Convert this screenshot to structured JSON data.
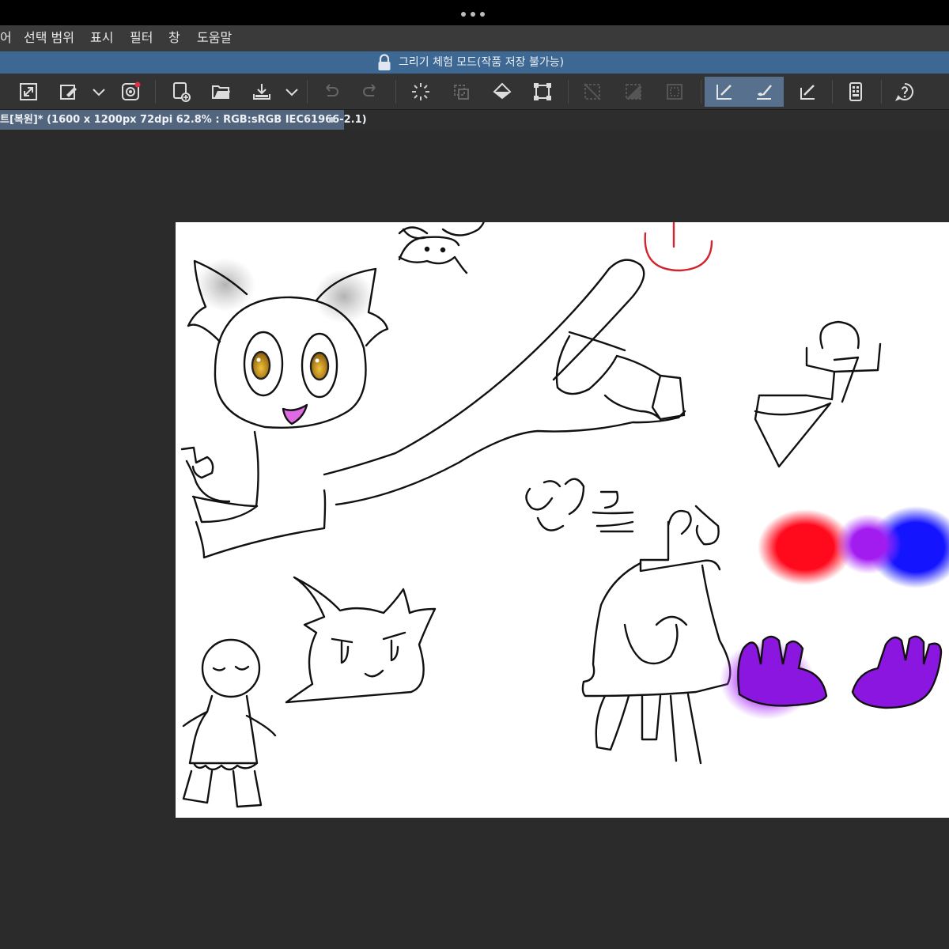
{
  "app": {
    "menu": [
      "어",
      "선택 범위",
      "표시",
      "필터",
      "창",
      "도움말"
    ]
  },
  "banner": {
    "text": "그리기 체험 모드(작품 저장 불가능)"
  },
  "toolbar": {
    "icons": [
      "resize-icon",
      "eyedropper-icon",
      "dropdown-icon",
      "layer-settings-icon",
      "new-canvas-icon",
      "open-folder-icon",
      "save-download-icon",
      "dropdown-icon",
      "undo-icon",
      "redo-icon",
      "loading-spinner-icon",
      "transform-icon",
      "fill-bucket-icon",
      "crop-transform-icon",
      "clear-selection-icon",
      "invert-selection-icon",
      "show-selection-icon",
      "pen-tool-icon",
      "brush-tool-icon",
      "eraser-tool-icon",
      "device-settings-icon",
      "help-icon"
    ]
  },
  "document": {
    "tab_title": "트[복원]* (1600 x 1200px 72dpi 62.8% : RGB:sRGB IEC61966-2.1)"
  },
  "colors": {
    "menubar": "#3a3a3a",
    "banner": "#3d6894",
    "active_tool": "#56708e",
    "workspace": "#2b2b2b",
    "canvas": "#ffffff"
  }
}
